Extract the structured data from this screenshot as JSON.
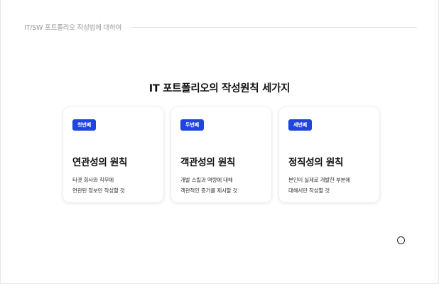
{
  "header": {
    "title": "IT/SW 포트폴리오 작성법에 대하여"
  },
  "main": {
    "title": "IT 포트폴리오의 작성원칙 세가지"
  },
  "cards": [
    {
      "badge": "첫번째",
      "title": "연관성의 원칙",
      "desc_line1": "타겟 회사와 직무에",
      "desc_line2": "연관된 정보만 작성할 것"
    },
    {
      "badge": "두번째",
      "title": "객관성의 원칙",
      "desc_line1": "개발 스킬과 역량에 대해",
      "desc_line2": "객관적인 증거를 제시할 것"
    },
    {
      "badge": "세번째",
      "title": "정직성의 원칙",
      "desc_line1": "본인이 실제로 개발한 부분에",
      "desc_line2": "대해서만 작성할 것"
    }
  ],
  "colors": {
    "badge_bg": "#1f44e0",
    "header_text": "#9a9a9a"
  }
}
